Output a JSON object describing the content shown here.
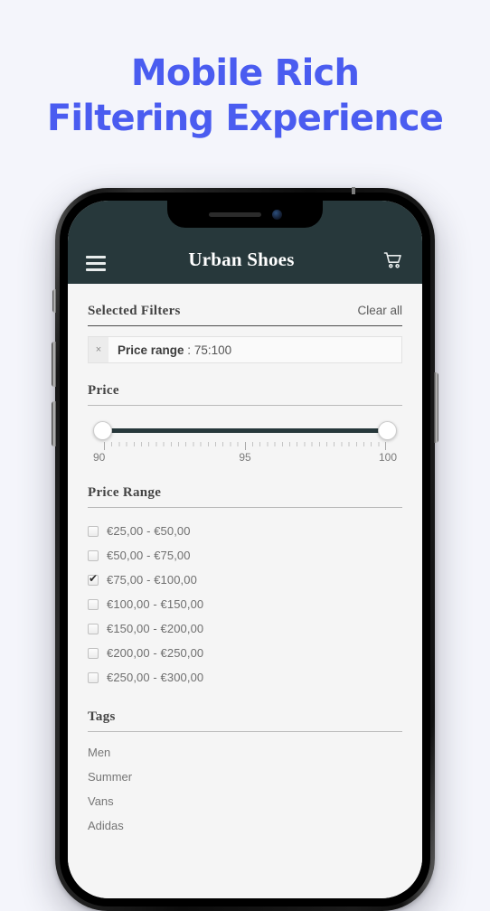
{
  "promo": {
    "line1": "Mobile Rich",
    "line2": "Filtering Experience",
    "color": "#4a5cf0"
  },
  "app_bar": {
    "title": "Urban Shoes",
    "menu_icon": "hamburger-icon",
    "cart_icon": "shopping-cart-icon",
    "background": "#27383b"
  },
  "selected_filters": {
    "title": "Selected Filters",
    "clear_all_label": "Clear all",
    "chips": [
      {
        "remove_label": "×",
        "name": "Price range",
        "separator": " : ",
        "value": "75:100"
      }
    ]
  },
  "price": {
    "title": "Price",
    "min_label": "90",
    "mid_label": "95",
    "max_label": "100",
    "handle_low": "90",
    "handle_high": "100",
    "track_color": "#27383b"
  },
  "price_range": {
    "title": "Price Range",
    "options": [
      {
        "label": "€25,00 - €50,00",
        "checked": false
      },
      {
        "label": "€50,00 - €75,00",
        "checked": false
      },
      {
        "label": "€75,00 - €100,00",
        "checked": true
      },
      {
        "label": "€100,00 - €150,00",
        "checked": false
      },
      {
        "label": "€150,00 - €200,00",
        "checked": false
      },
      {
        "label": "€200,00 - €250,00",
        "checked": false
      },
      {
        "label": "€250,00 - €300,00",
        "checked": false
      }
    ]
  },
  "tags": {
    "title": "Tags",
    "items": [
      {
        "label": "Men"
      },
      {
        "label": "Summer"
      },
      {
        "label": "Vans"
      },
      {
        "label": "Adidas"
      }
    ]
  }
}
